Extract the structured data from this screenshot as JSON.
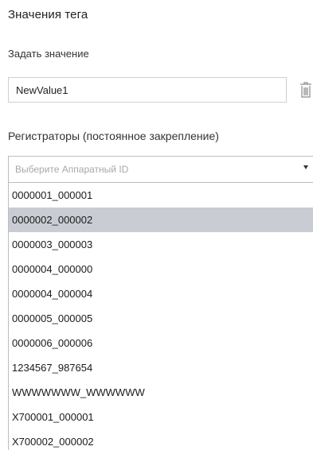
{
  "panel": {
    "title": "Значения тега",
    "set_value_label": "Задать значение",
    "value_input": "NewValue1",
    "delete_icon": "trash-icon",
    "registrars_label": "Регистраторы (постоянное закрепление)",
    "select_placeholder": "Выберите Аппаратный ID",
    "select_caret_icon": "chevron-down-icon"
  },
  "dropdown": {
    "selected_index": 1,
    "options": [
      "0000001_000001",
      "0000002_000002",
      "0000003_000003",
      "0000004_000000",
      "0000004_000004",
      "0000005_000005",
      "0000006_000006",
      "1234567_987654",
      "WWWWWWW_WWWWWW",
      "X700001_000001",
      "X700002_000002"
    ]
  },
  "colors": {
    "selected_row": "#c9cdd3",
    "border": "#bdbdbd",
    "placeholder_text": "#a8a8a8"
  }
}
